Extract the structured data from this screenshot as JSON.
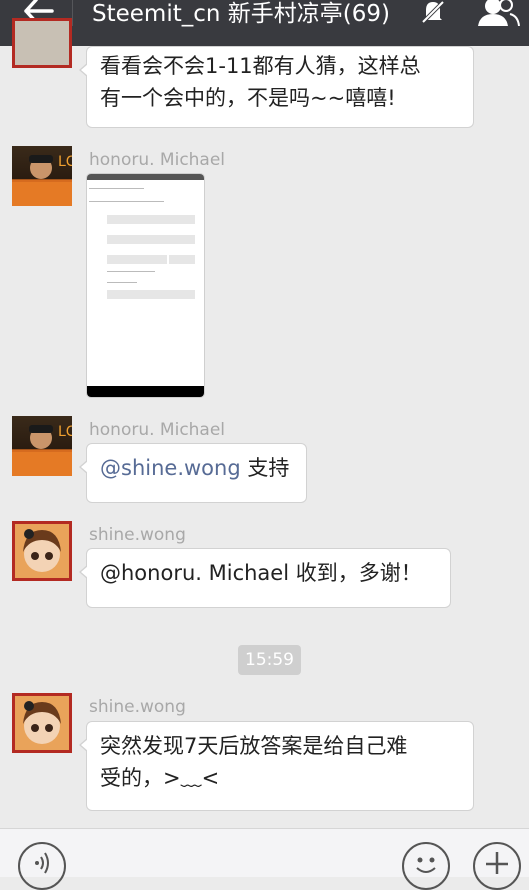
{
  "header": {
    "title": "Steemit_cn 新手村凉亭(69)",
    "back_icon": "arrow-left-icon",
    "mute_icon": "bell-muted-icon",
    "members_icon": "people-icon"
  },
  "messages": [
    {
      "text_line1": "看看会不会1-11都有人猜，这样总",
      "text_line2": "有一个会中的，不是吗~~嘻嘻!"
    },
    {
      "sender": "honoru. Michael",
      "type": "image"
    },
    {
      "sender": "honoru. Michael",
      "mention": "@shine.wong",
      "text": " 支持"
    },
    {
      "sender": "shine.wong",
      "text": "@honoru. Michael 收到，多谢！"
    },
    {
      "sender": "shine.wong",
      "text_line1": "突然发现7天后放答案是给自己难",
      "text_line2": "受的，>﹏<"
    }
  ],
  "timestamp": "15:59",
  "input_bar": {
    "voice_icon": "voice-icon",
    "emoji_icon": "emoji-icon",
    "plus_icon": "plus-icon"
  }
}
